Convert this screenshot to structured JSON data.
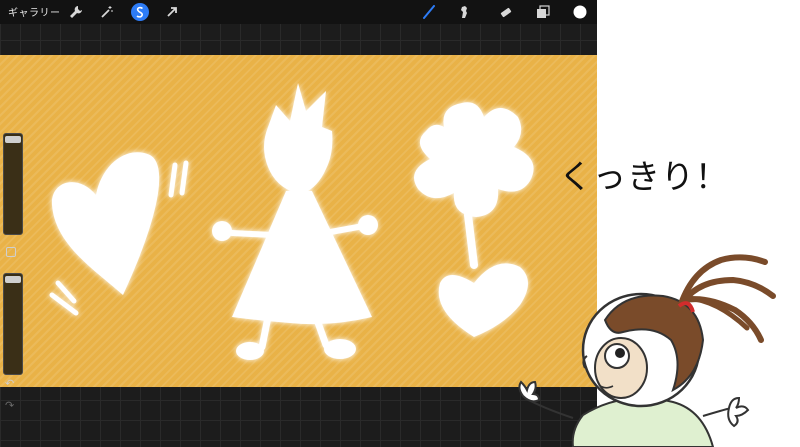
{
  "toolbar": {
    "gallery_label": "ギャラリー",
    "left_tools": [
      "wrench-icon",
      "magic-wand-icon",
      "selection-icon",
      "move-arrow-icon"
    ],
    "right_tools": [
      "brush-icon",
      "smudge-icon",
      "eraser-icon",
      "layers-icon",
      "color-swatch"
    ],
    "accent_color": "#2d7cf6",
    "current_color": "#ffffff"
  },
  "canvas": {
    "background_color": "#e9b247",
    "shapes": [
      "heart",
      "stick-figure",
      "flower"
    ]
  },
  "sidebar": {
    "undo_symbol": "↶",
    "redo_symbol": "↷"
  },
  "annotation": {
    "text": "くっきり！"
  }
}
